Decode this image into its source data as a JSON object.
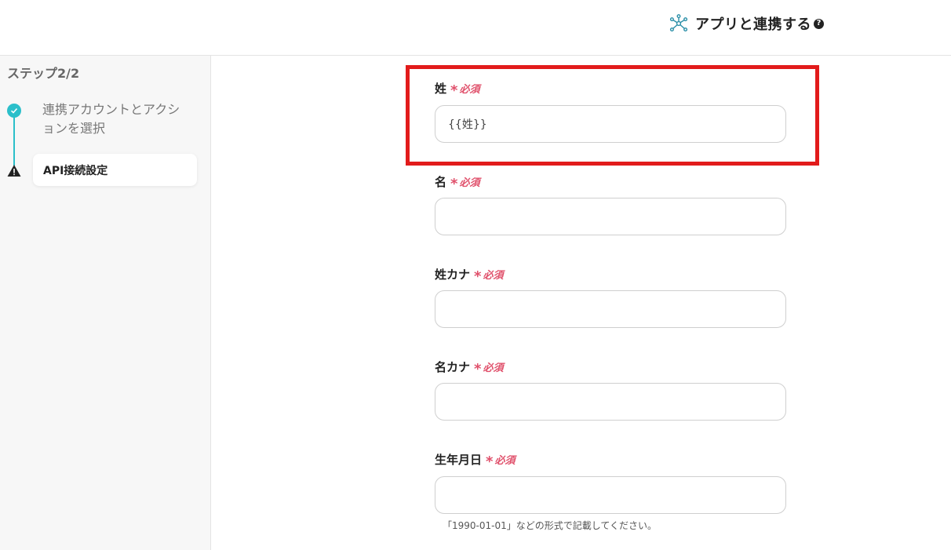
{
  "header": {
    "title": "アプリと連携する",
    "help_icon": "question-circle-icon"
  },
  "sidebar": {
    "step_title": "ステップ2/2",
    "steps": [
      {
        "label": "連携アカウントとアクションを選択",
        "status": "complete",
        "icon": "check-circle-icon"
      },
      {
        "label": "API接続設定",
        "status": "warning",
        "icon": "warning-triangle-icon",
        "active": true
      }
    ]
  },
  "form": {
    "required_text": "必須",
    "required_mark": "*",
    "fields": [
      {
        "label": "姓",
        "value": "{{姓}}",
        "highlighted": true
      },
      {
        "label": "名",
        "value": ""
      },
      {
        "label": "姓カナ",
        "value": ""
      },
      {
        "label": "名カナ",
        "value": ""
      },
      {
        "label": "生年月日",
        "value": ""
      }
    ],
    "hint": "「1990-01-01」などの形式で記載してください。"
  },
  "colors": {
    "accent": "#2bbfca",
    "required": "#e0506b",
    "highlight": "#e21b1b"
  }
}
